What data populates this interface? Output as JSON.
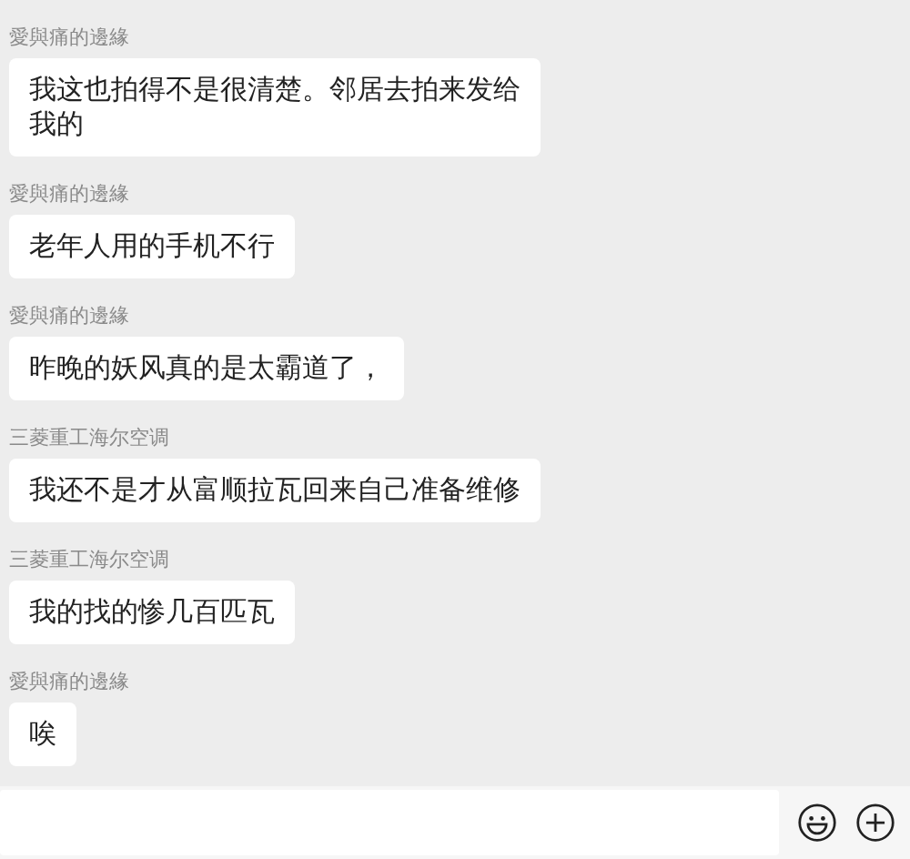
{
  "messages": [
    {
      "sender": "愛與痛的邊緣",
      "text": "我这也拍得不是很清楚。邻居去拍来发给我的"
    },
    {
      "sender": "愛與痛的邊緣",
      "text": "老年人用的手机不行"
    },
    {
      "sender": "愛與痛的邊緣",
      "text": "昨晚的妖风真的是太霸道了，"
    },
    {
      "sender": "三菱重工海尔空调",
      "text": "我还不是才从富顺拉瓦回来自己准备维修"
    },
    {
      "sender": "三菱重工海尔空调",
      "text": "我的找的惨几百匹瓦"
    },
    {
      "sender": "愛與痛的邊緣",
      "text": "唉"
    }
  ]
}
